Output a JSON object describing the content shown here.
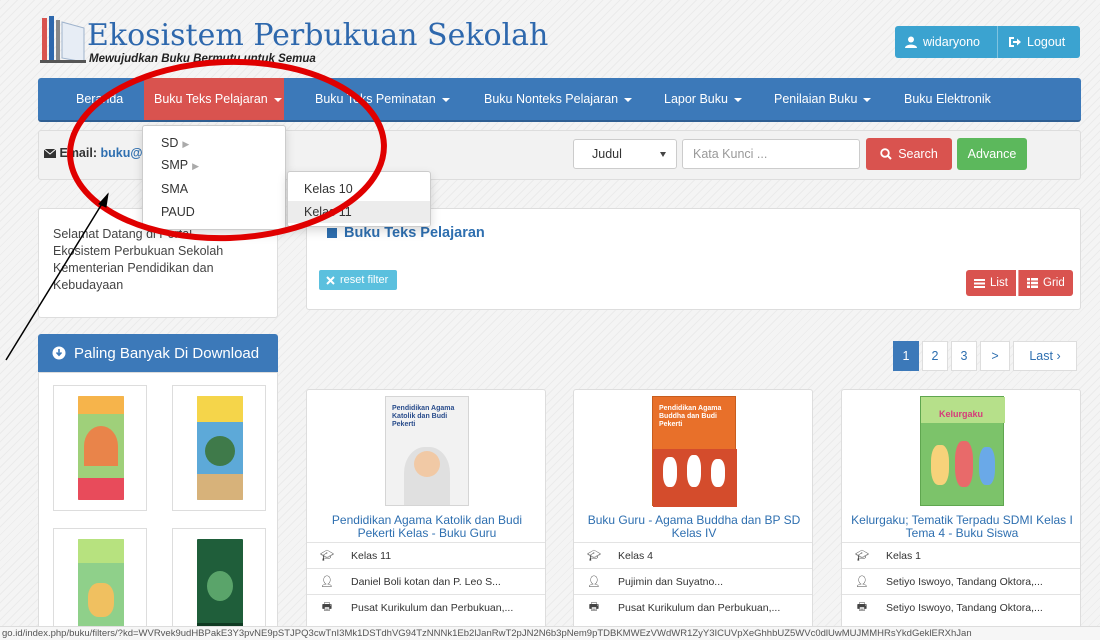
{
  "header": {
    "site_title": "Ekosistem Perbukuan Sekolah",
    "tagline": "Mewujudkan Buku Bermutu untuk Semua",
    "user_button": "widaryono",
    "logout_button": "Logout"
  },
  "nav": {
    "items": [
      {
        "label": "Beranda"
      },
      {
        "label": "Buku Teks Pelajaran"
      },
      {
        "label": "Buku Teks Peminatan"
      },
      {
        "label": "Buku Nonteks Pelajaran"
      },
      {
        "label": "Lapor Buku"
      },
      {
        "label": "Penilaian Buku"
      },
      {
        "label": "Buku Elektronik"
      }
    ],
    "dropdown": {
      "items": [
        "SD",
        "SMP",
        "SMA",
        "PAUD"
      ]
    },
    "submenu": {
      "items": [
        "Kelas 10",
        "Kelas 11"
      ]
    }
  },
  "search": {
    "email_label": "Email:",
    "email_value": "buku@",
    "select_value": "Judul",
    "keyword_placeholder": "Kata Kunci ...",
    "search_button": "Search",
    "advance_button": "Advance"
  },
  "welcome": {
    "text": "Selamat Datang di Portal Ekosistem Perbukuan Sekolah Kementerian Pendidikan dan Kebudayaan"
  },
  "content": {
    "section_title": "Buku Teks Pelajaran",
    "reset_filter": "reset filter",
    "view_list": "List",
    "view_grid": "Grid"
  },
  "sidebar": {
    "popular_title": "Paling Banyak Di Download"
  },
  "pagination": {
    "pages": [
      "1",
      "2",
      "3"
    ],
    "next": ">",
    "last": "Last ›",
    "current": "1"
  },
  "books": [
    {
      "title": "Pendidikan Agama Katolik dan Budi Pekerti Kelas - Buku Guru",
      "kelas": "Kelas 11",
      "penulis": "Daniel Boli kotan dan P. Leo S...",
      "penerbit": "Pusat Kurikulum dan Perbukuan,...",
      "cover_text": "Pendidikan Agama Katolik dan Budi Pekerti",
      "cover_color": "#f2f2f2"
    },
    {
      "title": "Buku Guru - Agama Buddha dan BP SD Kelas IV",
      "kelas": "Kelas 4",
      "penulis": "Pujimin dan Suyatno...",
      "penerbit": "Pusat Kurikulum dan Perbukuan,...",
      "cover_text": "Pendidikan Agama Buddha dan Budi Pekerti",
      "cover_color": "#e8702a"
    },
    {
      "title": "Kelurgaku; Tematik Terpadu SDMI Kelas I Tema 4 - Buku Siswa",
      "kelas": "Kelas 1",
      "penulis": "Setiyo Iswoyo, Tandang Oktora,...",
      "penerbit": "Setiyo Iswoyo, Tandang Oktora,...",
      "cover_text": "Kelurgaku",
      "cover_color": "#7cc36a"
    }
  ],
  "status_url": "go.id/index.php/buku/filters/?kd=WVRvek9udHBPakE3Y3pvNE9pSTJPQ3cwTnI3Mk1DSTdhVG94TzNNNk1Eb2lJanRwT2pJN2N6b3pNem9pTDBKMWEzVWdWR1ZyY3ICUVpXeGhhbUZ5WVc0dlUwMUJMMHRsYkdGeklERXhJan",
  "colors": {
    "primary": "#3c79b9",
    "danger": "#d9534f",
    "success": "#5cb85c",
    "info": "#5bc0de",
    "link": "#2e6fb0"
  },
  "icons": {
    "user": "user-icon",
    "logout": "logout-icon",
    "email": "envelope-icon",
    "search": "search-icon",
    "reset": "close-icon",
    "list": "list-icon",
    "grid": "grid-icon",
    "download": "download-circle-icon",
    "kelas": "graduation-cap-icon",
    "penulis": "user-icon",
    "penerbit": "printer-icon"
  }
}
